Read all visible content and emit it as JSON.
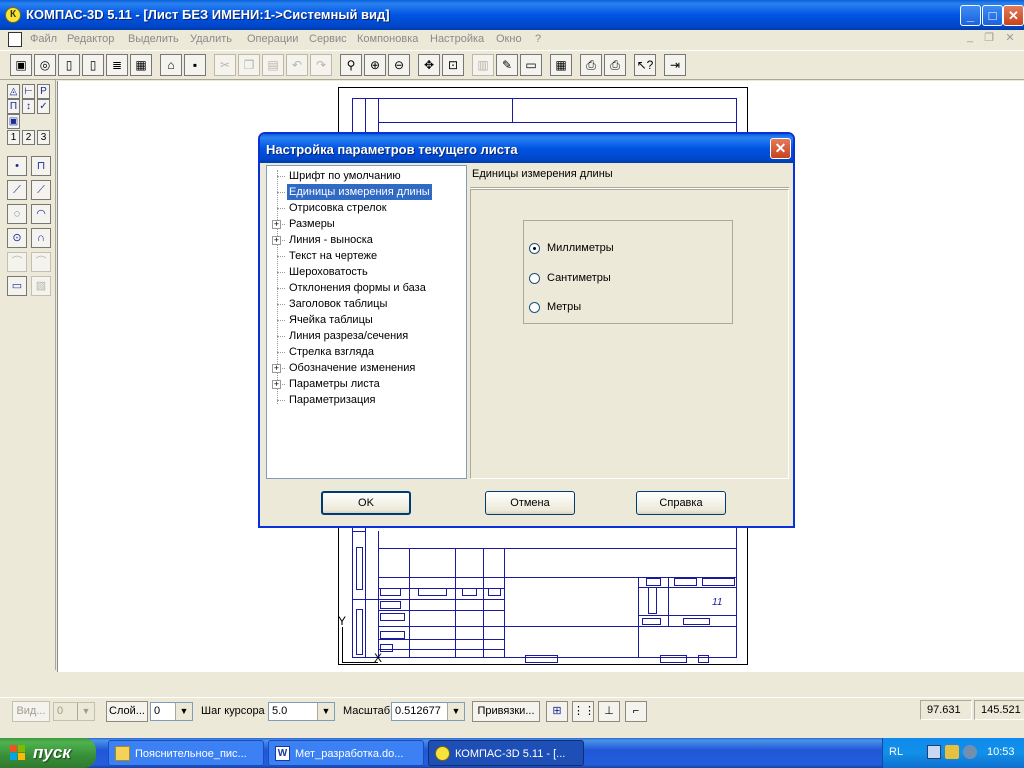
{
  "window": {
    "title": "КОМПАС-3D 5.11 - [Лист БЕЗ ИМЕНИ:1->Системный вид]",
    "minimize": "_",
    "maximize": "□",
    "close": "✕"
  },
  "menu": {
    "items": [
      "Файл",
      "Редактор",
      "Выделить",
      "Удалить",
      "Операции",
      "Сервис",
      "Компоновка",
      "Настройка",
      "Окно",
      "?"
    ],
    "mdi_minimize": "_",
    "mdi_restore": "❐",
    "mdi_close": "✕"
  },
  "toolbar": {
    "icons": [
      "new-document-icon",
      "new-fragment-icon",
      "new-sheet-icon",
      "new-text-doc-icon",
      "new-spec-icon",
      "new-table-icon",
      "open-folder-icon",
      "save-icon",
      "cut-icon",
      "copy-icon",
      "paste-icon",
      "undo-icon",
      "redo-icon",
      "zoom-icon",
      "zoom-in-icon",
      "zoom-out-icon",
      "pan-icon",
      "zoom-fit-icon",
      "layer-icon",
      "edit-pencil-icon",
      "properties-icon",
      "calculator-icon",
      "print-preview-icon",
      "print-icon",
      "help-cursor-icon",
      "exit-icon"
    ]
  },
  "left_tools": {
    "tabs": [
      "1",
      "2",
      "3"
    ]
  },
  "dialog": {
    "title": "Настройка параметров текущего листа",
    "close": "✕",
    "tree": [
      {
        "label": "Шрифт по умолчанию",
        "expandable": false,
        "selected": false
      },
      {
        "label": "Единицы измерения длины",
        "expandable": false,
        "selected": true
      },
      {
        "label": "Отрисовка стрелок",
        "expandable": false,
        "selected": false
      },
      {
        "label": "Размеры",
        "expandable": true,
        "selected": false
      },
      {
        "label": "Линия - выноска",
        "expandable": true,
        "selected": false
      },
      {
        "label": "Текст на чертеже",
        "expandable": false,
        "selected": false
      },
      {
        "label": "Шероховатость",
        "expandable": false,
        "selected": false
      },
      {
        "label": "Отклонения формы и база",
        "expandable": false,
        "selected": false
      },
      {
        "label": "Заголовок таблицы",
        "expandable": false,
        "selected": false
      },
      {
        "label": "Ячейка таблицы",
        "expandable": false,
        "selected": false
      },
      {
        "label": "Линия разреза/сечения",
        "expandable": false,
        "selected": false
      },
      {
        "label": "Стрелка взгляда",
        "expandable": false,
        "selected": false
      },
      {
        "label": "Обозначение изменения",
        "expandable": true,
        "selected": false
      },
      {
        "label": "Параметры листа",
        "expandable": true,
        "selected": false
      },
      {
        "label": "Параметризация",
        "expandable": false,
        "selected": false
      }
    ],
    "expand_glyph": "+",
    "panel_title": "Единицы измерения длины",
    "units": [
      {
        "label": "Миллиметры",
        "checked": true
      },
      {
        "label": "Сантиметры",
        "checked": false
      },
      {
        "label": "Метры",
        "checked": false
      }
    ],
    "buttons": {
      "ok": "OK",
      "cancel": "Отмена",
      "help": "Справка"
    }
  },
  "propbar": {
    "view_label": "Вид...",
    "view_value": "0",
    "layer_label": "Слой...",
    "layer_value": "0",
    "step_label": "Шаг курсора",
    "step_value": "5.0",
    "scale_label": "Масштаб",
    "scale_value": "0.512677",
    "snaps_label": "Привязки...",
    "drop_glyph": "▼",
    "coord_x": "97.631",
    "coord_y": "145.521"
  },
  "drawing": {
    "stamp_number": "11",
    "axis_y": "Y",
    "axis_x": "X"
  },
  "taskbar": {
    "start": "пуск",
    "tasks": [
      {
        "label": "Пояснительное_пис...",
        "active": false
      },
      {
        "label": "Мет_разработка.do...",
        "active": false
      },
      {
        "label": "КОМПАС-3D 5.11 - [...",
        "active": true
      }
    ],
    "lang": "RL",
    "clock": "10:53"
  },
  "colors": {
    "xp_blue": "#0054e3",
    "selection": "#316ac5",
    "drawing_line": "#1a1aa0",
    "start_green": "#3c9a3c"
  }
}
